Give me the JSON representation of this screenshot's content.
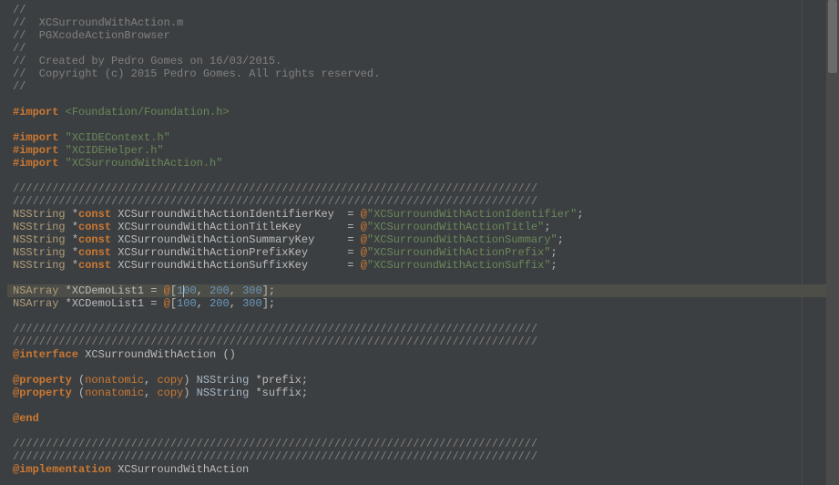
{
  "header_comments": [
    "//",
    "//  XCSurroundWithAction.m",
    "//  PGXcodeActionBrowser",
    "//",
    "//  Created by Pedro Gomes on 16/03/2015.",
    "//  Copyright (c) 2015 Pedro Gomes. All rights reserved.",
    "//"
  ],
  "imports": [
    {
      "directive": "#import",
      "target": "<Foundation/Foundation.h>"
    },
    {
      "directive": "#import",
      "target": "\"XCIDEContext.h\""
    },
    {
      "directive": "#import",
      "target": "\"XCIDEHelper.h\""
    },
    {
      "directive": "#import",
      "target": "\"XCSurroundWithAction.h\""
    }
  ],
  "divider": "////////////////////////////////////////////////////////////////////////////////",
  "constants": [
    {
      "type": "NSString",
      "star": "*",
      "const": "const",
      "name": "XCSurroundWithActionIdentifierKey",
      "pad": " ",
      "eq": "=",
      "at": "@",
      "value": "\"XCSurroundWithActionIdentifier\"",
      "semi": ";"
    },
    {
      "type": "NSString",
      "star": "*",
      "const": "const",
      "name": "XCSurroundWithActionTitleKey",
      "pad": "      ",
      "eq": "=",
      "at": "@",
      "value": "\"XCSurroundWithActionTitle\"",
      "semi": ";"
    },
    {
      "type": "NSString",
      "star": "*",
      "const": "const",
      "name": "XCSurroundWithActionSummaryKey",
      "pad": "    ",
      "eq": "=",
      "at": "@",
      "value": "\"XCSurroundWithActionSummary\"",
      "semi": ";"
    },
    {
      "type": "NSString",
      "star": "*",
      "const": "const",
      "name": "XCSurroundWithActionPrefixKey",
      "pad": "     ",
      "eq": "=",
      "at": "@",
      "value": "\"XCSurroundWithActionPrefix\"",
      "semi": ";"
    },
    {
      "type": "NSString",
      "star": "*",
      "const": "const",
      "name": "XCSurroundWithActionSuffixKey",
      "pad": "     ",
      "eq": "=",
      "at": "@",
      "value": "\"XCSurroundWithActionSuffix\"",
      "semi": ";"
    }
  ],
  "demo_lines": [
    {
      "type": "NSArray",
      "star": "*",
      "name": "XCDemoList1",
      "eq": "=",
      "at": "@",
      "lb": "[",
      "v1a": "1",
      "v1b": "00",
      "c1": ", ",
      "v2": "200",
      "c2": ", ",
      "v3": "300",
      "rb": "]",
      "semi": ";"
    },
    {
      "type": "NSArray",
      "star": "*",
      "name": "XCDemoList1",
      "eq": "=",
      "at": "@",
      "lb": "[",
      "v1a": "100",
      "v1b": "",
      "c1": ", ",
      "v2": "200",
      "c2": ", ",
      "v3": "300",
      "rb": "]",
      "semi": ";"
    }
  ],
  "interface": {
    "keyword": "@interface",
    "name": "XCSurroundWithAction",
    "parens": "()"
  },
  "properties": [
    {
      "keyword": "@property",
      "lp": "(",
      "attr1": "nonatomic",
      "comma": ", ",
      "attr2": "copy",
      "rp": ")",
      "type": "NSString",
      "star": "*",
      "name": "prefix",
      "semi": ";"
    },
    {
      "keyword": "@property",
      "lp": "(",
      "attr1": "nonatomic",
      "comma": ", ",
      "attr2": "copy",
      "rp": ")",
      "type": "NSString",
      "star": "*",
      "name": "suffix",
      "semi": ";"
    }
  ],
  "end": "@end",
  "implementation": {
    "keyword": "@implementation",
    "name": "XCSurroundWithAction"
  }
}
